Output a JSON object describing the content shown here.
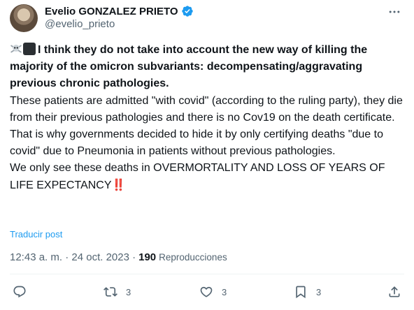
{
  "author": {
    "display_name": "Evelio GONZALEZ PRIETO",
    "handle": "@evelio_prieto",
    "verified": true
  },
  "tweet": {
    "bold_text": "I think they do not take into account the new way of killing the majority of the omicron subvariants: decompensating/aggravating previous chronic pathologies.",
    "paragraphs": [
      "These patients are admitted \"with covid\" (according to the ruling party), they die from their previous pathologies and there is no Cov19 on the death certificate.",
      "That is why governments decided to hide it by only certifying deaths \"due to covid\" due to Pneumonia in patients without previous pathologies.",
      "We only see these deaths in OVERMORTALITY AND LOSS OF YEARS OF LIFE EXPECTANCY"
    ],
    "emoji_prefix": [
      "skull-crossbones",
      "black-square"
    ],
    "emoji_suffix": "‼️"
  },
  "translate_label": "Traducir post",
  "meta": {
    "timestamp": "12:43 a. m. · 24 oct. 2023 ·",
    "views_count": "190",
    "views_label": "Reproducciones"
  },
  "actions": {
    "reply_count": "",
    "retweet_count": "3",
    "like_count": "3",
    "bookmark_count": "3"
  },
  "colors": {
    "accent": "#1d9bf0",
    "text": "#0f1419",
    "secondary": "#536471",
    "divider": "#eff3f4"
  }
}
